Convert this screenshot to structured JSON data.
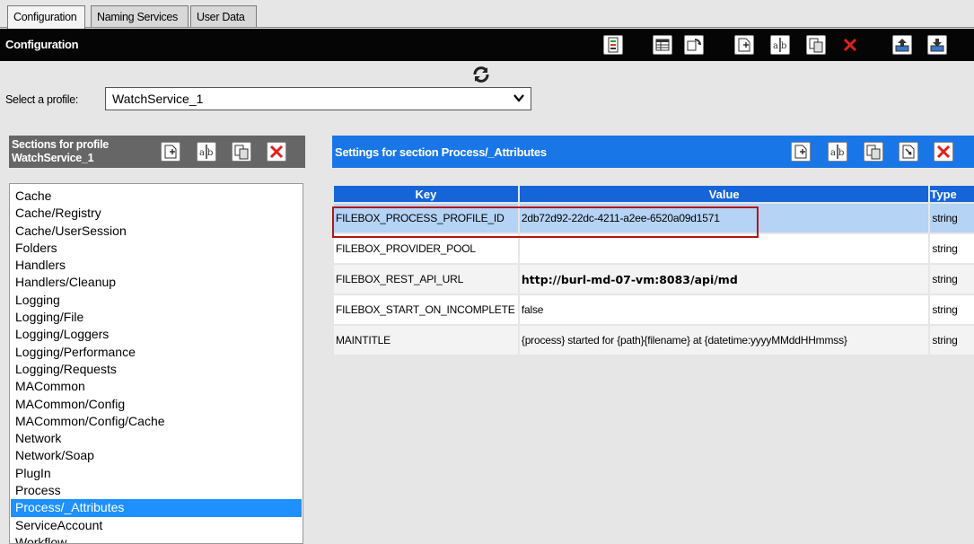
{
  "tabs": [
    {
      "label": "Configuration",
      "active": true
    },
    {
      "label": "Naming Services",
      "active": false
    },
    {
      "label": "User Data",
      "active": false
    }
  ],
  "header": {
    "title": "Configuration",
    "toolbar_icons": [
      "notes-icon",
      "table-icon",
      "refresh-icon",
      "add-icon",
      "rename-icon",
      "copy-icon",
      "delete-icon",
      "upload-icon",
      "download-icon"
    ]
  },
  "profile": {
    "label": "Select a profile:",
    "selected": "WatchService_1"
  },
  "sections_panel": {
    "title_line1": "Sections for profile",
    "title_line2": "WatchService_1",
    "items": [
      "Cache",
      "Cache/Registry",
      "Cache/UserSession",
      "Folders",
      "Handlers",
      "Handlers/Cleanup",
      "Logging",
      "Logging/File",
      "Logging/Loggers",
      "Logging/Performance",
      "Logging/Requests",
      "MACommon",
      "MACommon/Config",
      "MACommon/Config/Cache",
      "Network",
      "Network/Soap",
      "PlugIn",
      "Process",
      "Process/_Attributes",
      "ServiceAccount",
      "Workflow"
    ],
    "selected": "Process/_Attributes"
  },
  "settings_panel": {
    "title": "Settings for section Process/_Attributes",
    "columns": [
      "Key",
      "Value",
      "Type"
    ],
    "rows": [
      {
        "key": "FILEBOX_PROCESS_PROFILE_ID",
        "value": "2db72d92-22dc-4211-a2ee-6520a09d1571",
        "type": "string"
      },
      {
        "key": "FILEBOX_PROVIDER_POOL",
        "value": "",
        "type": "string"
      },
      {
        "key": "FILEBOX_REST_API_URL",
        "value": "http://burl-md-07-vm:8083/api/md",
        "type": "string"
      },
      {
        "key": "FILEBOX_START_ON_INCOMPLETE",
        "value": "false",
        "type": "string"
      },
      {
        "key": "MAINTITLE",
        "value": "{process} started for {path}{filename} at {datetime:yyyyMMddHHmmss}",
        "type": "string"
      }
    ]
  },
  "colors": {
    "header_bg": "#050505",
    "sections_header_bg": "#666666",
    "settings_header_bg": "#1976e6",
    "selection": "#1e90ff",
    "highlight_border": "#b01818"
  }
}
